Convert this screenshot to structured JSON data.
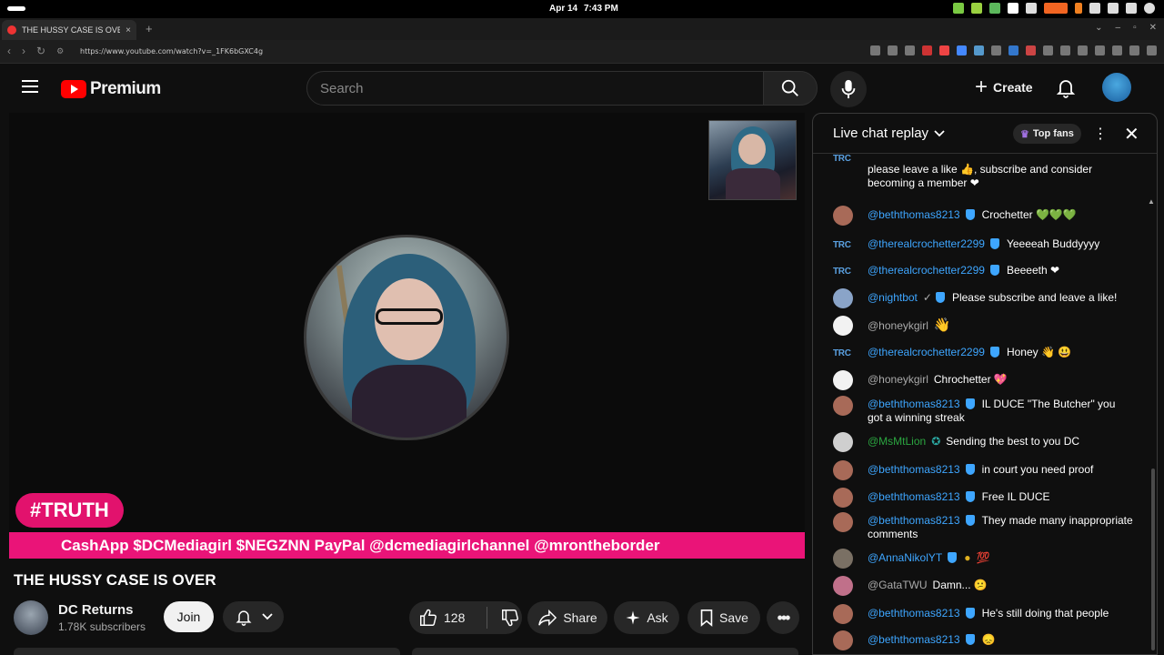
{
  "os": {
    "date": "Apr 14",
    "time": "7:43 PM"
  },
  "browser": {
    "tab_title": "THE HUSSY CASE IS OVER",
    "tab_close": "×",
    "new_tab": "+",
    "url": "https://www.youtube.com/watch?v=_1FK6bGXC4g"
  },
  "header": {
    "logo_text": "Premium",
    "search_placeholder": "Search",
    "create_label": "Create"
  },
  "video": {
    "overlay_badge": "#TRUTH",
    "ticker": "CashApp $DCMediagirl $NEGZNN PayPal @dcmediagirlchannel @mrontheborder",
    "title": "THE HUSSY CASE IS OVER",
    "channel_name": "DC Returns",
    "subscribers": "1.78K subscribers",
    "join_label": "Join",
    "like_count": "128",
    "share_label": "Share",
    "ask_label": "Ask",
    "save_label": "Save"
  },
  "chat": {
    "title": "Live chat replay",
    "top_fans": "Top fans",
    "messages": [
      {
        "author": "",
        "text": "please leave a like 👍, subscribe and consider becoming a member ❤"
      },
      {
        "author": "@beththomas8213",
        "text": "Crochetter 💚💚💚"
      },
      {
        "author": "@therealcrochetter2299",
        "text": "Yeeeeah Buddyyyy"
      },
      {
        "author": "@therealcrochetter2299",
        "text": "Beeeeth ❤"
      },
      {
        "author": "@nightbot",
        "text": "Please subscribe and leave a like!"
      },
      {
        "author": "@honeykgirl",
        "text": "👋"
      },
      {
        "author": "@therealcrochetter2299",
        "text": "Honey 👋 😃"
      },
      {
        "author": "@honeykgirl",
        "text": "Chrochetter 💖"
      },
      {
        "author": "@beththomas8213",
        "text": "IL DUCE \"The Butcher\" you got a winning streak"
      },
      {
        "author": "@MsMtLion",
        "text": "Sending the best to you DC"
      },
      {
        "author": "@beththomas8213",
        "text": "in court you need proof"
      },
      {
        "author": "@beththomas8213",
        "text": "Free IL DUCE"
      },
      {
        "author": "@beththomas8213",
        "text": "They made many inappropriate comments"
      },
      {
        "author": "@AnnaNikolYT",
        "text": "💯"
      },
      {
        "author": "@GataTWU",
        "text": "Damn... 😕"
      },
      {
        "author": "@beththomas8213",
        "text": "He's still doing that people"
      },
      {
        "author": "@beththomas8213",
        "text": "😞"
      }
    ],
    "trc_label": "TRC"
  },
  "colors": {
    "yt_red": "#ff0000",
    "ticker_pink": "#ea1478",
    "author_blue": "#3ea6ff",
    "member_green": "#2ba640"
  }
}
